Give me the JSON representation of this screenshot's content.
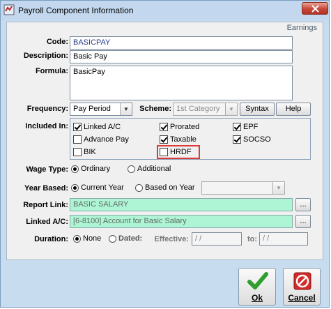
{
  "window": {
    "title": "Payroll Component Information"
  },
  "header": {
    "category": "Earnings"
  },
  "code": {
    "label": "Code:",
    "value": "BASICPAY"
  },
  "description": {
    "label": "Description:",
    "value": "Basic Pay"
  },
  "formula": {
    "label": "Formula:",
    "value": "BasicPay"
  },
  "frequency": {
    "label": "Frequency:",
    "value": "Pay Period"
  },
  "scheme": {
    "label": "Scheme:",
    "value": "1st Category"
  },
  "buttons": {
    "syntax": "Syntax",
    "help": "Help",
    "ok": "Ok",
    "cancel": "Cancel",
    "ellipsis": "..."
  },
  "included": {
    "label": "Included In:",
    "items": [
      {
        "label": "Linked A/C",
        "checked": true
      },
      {
        "label": "Prorated",
        "checked": true
      },
      {
        "label": "EPF",
        "checked": true
      },
      {
        "label": "Advance Pay",
        "checked": false
      },
      {
        "label": "Taxable",
        "checked": true
      },
      {
        "label": "SOCSO",
        "checked": true
      },
      {
        "label": "BIK",
        "checked": false
      },
      {
        "label": "HRDF",
        "checked": false
      }
    ]
  },
  "wage_type": {
    "label": "Wage Type:",
    "options": [
      "Ordinary",
      "Additional"
    ],
    "selected": "Ordinary"
  },
  "year_based": {
    "label": "Year Based:",
    "options": [
      "Current Year",
      "Based on Year"
    ],
    "selected": "Current Year"
  },
  "report_link": {
    "label": "Report Link:",
    "value": "BASIC SALARY"
  },
  "linked_ac": {
    "label": "Linked A/C:",
    "value": "[6-8100] Account for Basic Salary"
  },
  "duration": {
    "label": "Duration:",
    "options": [
      "None",
      "Dated:"
    ],
    "selected": "None",
    "effective_label": "Effective:",
    "effective_value": "/ /",
    "to_label": "to:",
    "to_value": "/ /"
  },
  "colors": {
    "link_field": "#aef5d5",
    "highlight": "#e0393a",
    "frame": "#c8dcf0"
  }
}
